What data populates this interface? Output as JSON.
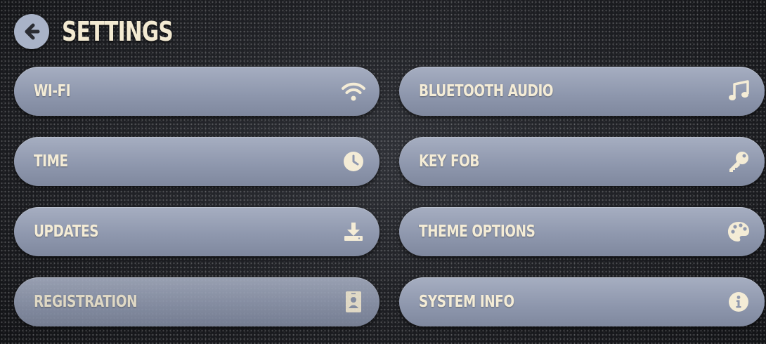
{
  "header": {
    "title": "SETTINGS",
    "back_icon": "arrow-left-circle-icon"
  },
  "menu": {
    "left": [
      {
        "label": "WI-FI",
        "icon": "wifi-icon"
      },
      {
        "label": "TIME",
        "icon": "clock-icon"
      },
      {
        "label": "UPDATES",
        "icon": "download-icon"
      },
      {
        "label": "REGISTRATION",
        "icon": "id-badge-icon"
      }
    ],
    "right": [
      {
        "label": "BLUETOOTH AUDIO",
        "icon": "music-note-icon"
      },
      {
        "label": "KEY FOB",
        "icon": "key-icon"
      },
      {
        "label": "THEME OPTIONS",
        "icon": "palette-icon"
      },
      {
        "label": "SYSTEM INFO",
        "icon": "info-icon"
      }
    ]
  },
  "colors": {
    "button": "#959eb3",
    "text": "#f4ecd6",
    "background": "#1c1d21"
  }
}
